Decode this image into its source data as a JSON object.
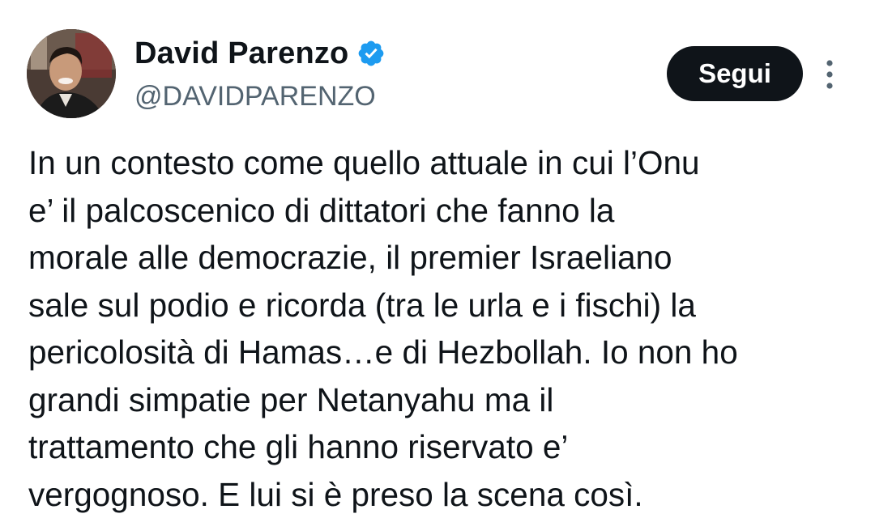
{
  "author": {
    "display_name": "David Parenzo",
    "handle": "@DAVIDPARENZO",
    "verified": true,
    "verified_icon": "verified-badge-icon",
    "verified_color": "#1d9bf0"
  },
  "actions": {
    "follow_label": "Segui",
    "more_icon": "more-vertical-icon"
  },
  "tweet": {
    "lines": [
      "In un contesto come quello attuale in cui l’Onu",
      "e’ il palcoscenico di dittatori che fanno la",
      "morale alle democrazie, il premier Israeliano",
      "sale sul podio e ricorda (tra le urla e i fischi) la",
      "pericolosità di Hamas…e di Hezbollah. Io non ho",
      "grandi simpatie per Netanyahu ma il",
      "trattamento che gli hanno riservato e’",
      "vergognoso. E lui si è preso la scena così."
    ]
  },
  "colors": {
    "text": "#0f1419",
    "secondary": "#536471",
    "button_bg": "#0f1419",
    "button_text": "#ffffff"
  }
}
